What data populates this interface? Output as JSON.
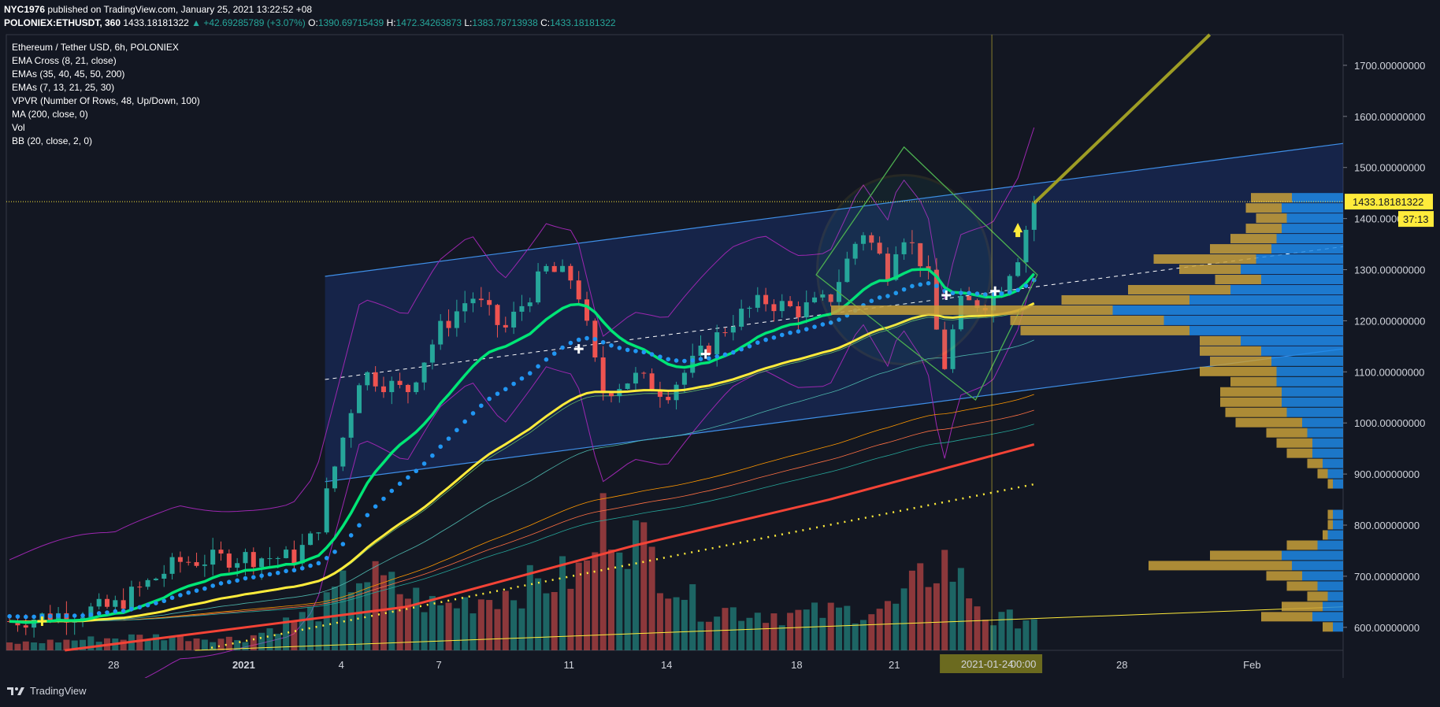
{
  "header": {
    "publisher": "NYC1976",
    "published_text": "published on TradingView.com, January 25, 2021 13:22:52 +08",
    "symbol": "POLONIEX:ETHUSDT, 360",
    "last": "1433.18181322",
    "change": "▲ +42.69285789 (+3.07%)",
    "open_label": "O:",
    "open": "1390.69715439",
    "high_label": "H:",
    "high": "1472.34263873",
    "low_label": "L:",
    "low": "1383.78713938",
    "close_label": "C:",
    "close": "1433.18181322"
  },
  "legend": [
    "Ethereum / Tether USD, 6h, POLONIEX",
    "EMA Cross (8, 21, close)",
    "EMAs (35, 40, 45, 50, 200)",
    "EMAs (7, 13, 21, 25, 30)",
    "VPVR (Number Of Rows, 48, Up/Down, 100)",
    "MA (200, close, 0)",
    "Vol",
    "BB (20, close, 2, 0)"
  ],
  "brand": "TradingView",
  "colors": {
    "up": "#26a69a",
    "down": "#ef5350",
    "ema_fast": "#00e676",
    "ema_slow": "#ffeb3b",
    "ma200": "#f44336",
    "dots": "#2196f3",
    "channel": "#2962ff",
    "bb": "#9c27b0",
    "vp_up": "#1e88e5",
    "vp_down": "#c8a03a",
    "price_tag": "#ffeb3b"
  },
  "chart_data": {
    "type": "candlestick",
    "timeframe": "6h",
    "y_axis": {
      "range": [
        555,
        1760
      ],
      "ticks": [
        "1700.00000000",
        "1600.00000000",
        "1500.00000000",
        "1400.00000000",
        "1300.00000000",
        "1200.00000000",
        "1100.00000000",
        "1000.00000000",
        "900.00000000",
        "800.00000000",
        "700.00000000",
        "600.00000000"
      ],
      "tick_values": [
        1700,
        1600,
        1500,
        1400,
        1300,
        1200,
        1100,
        1000,
        900,
        800,
        700,
        600
      ]
    },
    "x_axis": {
      "ticks": [
        {
          "label": "28",
          "day": -4,
          "bold": false
        },
        {
          "label": "2021",
          "day": 0,
          "bold": true
        },
        {
          "label": "4",
          "day": 3,
          "bold": false
        },
        {
          "label": "7",
          "day": 6,
          "bold": false
        },
        {
          "label": "11",
          "day": 10,
          "bold": false
        },
        {
          "label": "14",
          "day": 13,
          "bold": false
        },
        {
          "label": "18",
          "day": 17,
          "bold": false
        },
        {
          "label": "21",
          "day": 20,
          "bold": false
        },
        {
          "label": "25",
          "day": 24,
          "bold": false
        },
        {
          "label": "28",
          "day": 27,
          "bold": false
        },
        {
          "label": "Feb",
          "day": 31,
          "bold": false
        }
      ],
      "range_days": [
        -7.3,
        33.8
      ]
    },
    "last_price": {
      "label": "1433.18181322",
      "value": 1433.18,
      "countdown": "37:13"
    },
    "crosshair": {
      "label": "2021-01-24",
      "time_label": "00:00",
      "day": 23.0
    },
    "key_points": [
      {
        "day": -7.2,
        "close": 612
      },
      {
        "day": -4,
        "close": 640
      },
      {
        "day": -2,
        "close": 728
      },
      {
        "day": 0,
        "close": 738
      },
      {
        "day": 1.5,
        "close": 736
      },
      {
        "day": 2.2,
        "close": 780
      },
      {
        "day": 3,
        "close": 960
      },
      {
        "day": 3.6,
        "close": 1100
      },
      {
        "day": 5,
        "close": 1060
      },
      {
        "day": 6,
        "close": 1180
      },
      {
        "day": 7,
        "close": 1250
      },
      {
        "day": 8,
        "close": 1180
      },
      {
        "day": 9.3,
        "close": 1300
      },
      {
        "day": 10.2,
        "close": 1280
      },
      {
        "day": 11,
        "close": 1060
      },
      {
        "day": 12,
        "close": 1090
      },
      {
        "day": 13,
        "close": 1060
      },
      {
        "day": 14,
        "close": 1130
      },
      {
        "day": 15,
        "close": 1200
      },
      {
        "day": 16,
        "close": 1240
      },
      {
        "day": 17,
        "close": 1220
      },
      {
        "day": 18,
        "close": 1240
      },
      {
        "day": 19,
        "close": 1380
      },
      {
        "day": 19.8,
        "close": 1300
      },
      {
        "day": 20.2,
        "close": 1380
      },
      {
        "day": 21,
        "close": 1300
      },
      {
        "day": 21.5,
        "close": 1100
      },
      {
        "day": 22,
        "close": 1230
      },
      {
        "day": 23,
        "close": 1240
      },
      {
        "day": 23.8,
        "close": 1330
      },
      {
        "day": 24.3,
        "close": 1433
      }
    ],
    "volume": {
      "max_day": 11.2,
      "points": [
        {
          "day": -7,
          "v": 0.05
        },
        {
          "day": -3,
          "v": 0.1
        },
        {
          "day": 0,
          "v": 0.08
        },
        {
          "day": 2.5,
          "v": 0.3
        },
        {
          "day": 3.5,
          "v": 0.55
        },
        {
          "day": 6,
          "v": 0.3
        },
        {
          "day": 10.5,
          "v": 0.55
        },
        {
          "day": 11.2,
          "v": 1.0
        },
        {
          "day": 14,
          "v": 0.3
        },
        {
          "day": 17,
          "v": 0.25
        },
        {
          "day": 20,
          "v": 0.3
        },
        {
          "day": 21.5,
          "v": 0.65
        },
        {
          "day": 23,
          "v": 0.2
        },
        {
          "day": 24.3,
          "v": 0.25
        }
      ]
    },
    "ma200": [
      {
        "day": -5.5,
        "value": 555
      },
      {
        "day": 5,
        "value": 640
      },
      {
        "day": 12,
        "value": 760
      },
      {
        "day": 18,
        "value": 850
      },
      {
        "day": 24.3,
        "value": 958
      }
    ],
    "ma200_proj": [
      {
        "day": -1,
        "value": 560
      },
      {
        "day": 24.3,
        "value": 880
      }
    ],
    "long_ma": [
      {
        "day": -1.5,
        "value": 555
      },
      {
        "day": 33.8,
        "value": 640
      }
    ],
    "channel": {
      "upper": [
        {
          "day": 2.5,
          "value": 1287
        },
        {
          "day": 33.8,
          "value": 1547
        }
      ],
      "lower": [
        {
          "day": 2.5,
          "value": 885
        },
        {
          "day": 33.8,
          "value": 1145
        }
      ],
      "mid": [
        {
          "day": 2.5,
          "value": 1085
        },
        {
          "day": 33.8,
          "value": 1345
        }
      ]
    },
    "projection_arrow": [
      {
        "day": 24.3,
        "value": 1430
      },
      {
        "day": 29.7,
        "value": 1760
      }
    ],
    "volume_profile": [
      {
        "price": 1440,
        "up": 0.1,
        "down": 0.08
      },
      {
        "price": 1420,
        "up": 0.12,
        "down": 0.07
      },
      {
        "price": 1400,
        "up": 0.11,
        "down": 0.06
      },
      {
        "price": 1380,
        "up": 0.12,
        "down": 0.07
      },
      {
        "price": 1360,
        "up": 0.13,
        "down": 0.09
      },
      {
        "price": 1340,
        "up": 0.14,
        "down": 0.12
      },
      {
        "price": 1320,
        "up": 0.17,
        "down": 0.2
      },
      {
        "price": 1300,
        "up": 0.2,
        "down": 0.12
      },
      {
        "price": 1280,
        "up": 0.16,
        "down": 0.09
      },
      {
        "price": 1260,
        "up": 0.22,
        "down": 0.2
      },
      {
        "price": 1240,
        "up": 0.3,
        "down": 0.25
      },
      {
        "price": 1220,
        "up": 0.45,
        "down": 0.55
      },
      {
        "price": 1200,
        "up": 0.35,
        "down": 0.3
      },
      {
        "price": 1180,
        "up": 0.3,
        "down": 0.33
      },
      {
        "price": 1160,
        "up": 0.2,
        "down": 0.08
      },
      {
        "price": 1140,
        "up": 0.16,
        "down": 0.12
      },
      {
        "price": 1120,
        "up": 0.14,
        "down": 0.12
      },
      {
        "price": 1100,
        "up": 0.13,
        "down": 0.15
      },
      {
        "price": 1080,
        "up": 0.13,
        "down": 0.09
      },
      {
        "price": 1060,
        "up": 0.12,
        "down": 0.12
      },
      {
        "price": 1040,
        "up": 0.12,
        "down": 0.12
      },
      {
        "price": 1020,
        "up": 0.11,
        "down": 0.12
      },
      {
        "price": 1000,
        "up": 0.08,
        "down": 0.13
      },
      {
        "price": 980,
        "up": 0.07,
        "down": 0.08
      },
      {
        "price": 960,
        "up": 0.06,
        "down": 0.07
      },
      {
        "price": 940,
        "up": 0.06,
        "down": 0.05
      },
      {
        "price": 920,
        "up": 0.04,
        "down": 0.03
      },
      {
        "price": 900,
        "up": 0.03,
        "down": 0.02
      },
      {
        "price": 880,
        "up": 0.02,
        "down": 0.01
      },
      {
        "price": 820,
        "up": 0.02,
        "down": 0.01
      },
      {
        "price": 800,
        "up": 0.02,
        "down": 0.01
      },
      {
        "price": 780,
        "up": 0.03,
        "down": 0.01
      },
      {
        "price": 760,
        "up": 0.05,
        "down": 0.06
      },
      {
        "price": 740,
        "up": 0.12,
        "down": 0.14
      },
      {
        "price": 720,
        "up": 0.1,
        "down": 0.28
      },
      {
        "price": 700,
        "up": 0.08,
        "down": 0.07
      },
      {
        "price": 680,
        "up": 0.05,
        "down": 0.06
      },
      {
        "price": 660,
        "up": 0.03,
        "down": 0.04
      },
      {
        "price": 640,
        "up": 0.04,
        "down": 0.08
      },
      {
        "price": 620,
        "up": 0.06,
        "down": 0.1
      },
      {
        "price": 600,
        "up": 0.02,
        "down": 0.02
      }
    ]
  }
}
